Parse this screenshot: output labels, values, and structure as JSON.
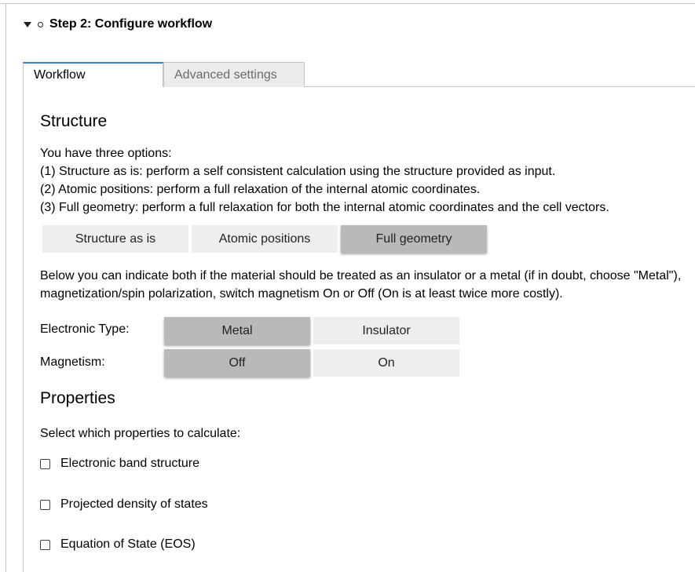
{
  "step": {
    "title": "Step 2: Configure workflow"
  },
  "tabs": [
    {
      "label": "Workflow",
      "active": true
    },
    {
      "label": "Advanced settings",
      "active": false
    }
  ],
  "structure": {
    "heading": "Structure",
    "intro": "You have three options:",
    "option_1": "(1) Structure as is: perform a self consistent calculation using the structure provided as input.",
    "option_2": "(2) Atomic positions: perform a full relaxation of the internal atomic coordinates.",
    "option_3": "(3) Full geometry: perform a full relaxation for both the internal atomic coordinates and the cell vectors.",
    "buttons": [
      "Structure as is",
      "Atomic positions",
      "Full geometry"
    ],
    "selected": "Full geometry"
  },
  "material": {
    "description_line_1": "Below you can indicate both if the material should be treated as an insulator or a metal (if in doubt, choose \"Metal\"),",
    "description_line_2": "magnetization/spin polarization, switch magnetism On or Off (On is at least twice more costly).",
    "electronic_type": {
      "label": "Electronic Type:",
      "options": [
        "Metal",
        "Insulator"
      ],
      "selected": "Metal"
    },
    "magnetism": {
      "label": "Magnetism:",
      "options": [
        "Off",
        "On"
      ],
      "selected": "Off"
    }
  },
  "properties": {
    "heading": "Properties",
    "prompt": "Select which properties to calculate:",
    "items": [
      {
        "label": "Electronic band structure",
        "checked": false
      },
      {
        "label": "Projected density of states",
        "checked": false
      },
      {
        "label": "Equation of State (EOS)",
        "checked": false
      }
    ]
  },
  "colors": {
    "accent": "#2f7cd7",
    "selected_button": "#b9b9b9",
    "unselected_button": "#eeeeee"
  }
}
